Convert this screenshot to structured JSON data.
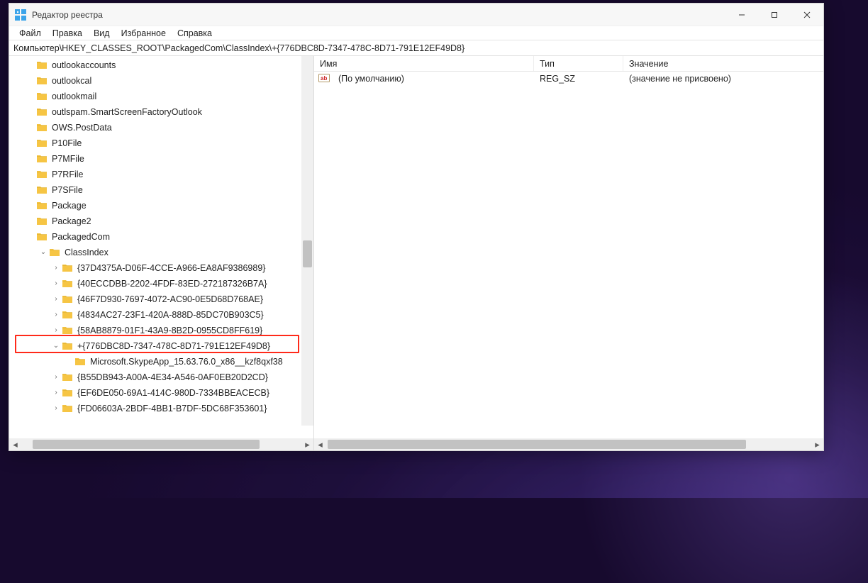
{
  "window": {
    "title": "Редактор реестра",
    "minimize": "—",
    "maximize": "▢",
    "close": "✕"
  },
  "menu": {
    "file": "Файл",
    "edit": "Правка",
    "view": "Вид",
    "favorites": "Избранное",
    "help": "Справка"
  },
  "pathbar": "Компьютер\\HKEY_CLASSES_ROOT\\PackagedCom\\ClassIndex\\+{776DBC8D-7347-478C-8D71-791E12EF49D8}",
  "tree": {
    "items": [
      {
        "indent": 1,
        "exp": "",
        "label": "outlookaccounts"
      },
      {
        "indent": 1,
        "exp": "",
        "label": "outlookcal"
      },
      {
        "indent": 1,
        "exp": "",
        "label": "outlookmail"
      },
      {
        "indent": 1,
        "exp": "",
        "label": "outlspam.SmartScreenFactoryOutlook"
      },
      {
        "indent": 1,
        "exp": "",
        "label": "OWS.PostData"
      },
      {
        "indent": 1,
        "exp": "",
        "label": "P10File"
      },
      {
        "indent": 1,
        "exp": "",
        "label": "P7MFile"
      },
      {
        "indent": 1,
        "exp": "",
        "label": "P7RFile"
      },
      {
        "indent": 1,
        "exp": "",
        "label": "P7SFile"
      },
      {
        "indent": 1,
        "exp": "",
        "label": "Package"
      },
      {
        "indent": 1,
        "exp": "",
        "label": "Package2"
      },
      {
        "indent": 1,
        "exp": "",
        "label": "PackagedCom"
      },
      {
        "indent": 2,
        "exp": "open",
        "label": "ClassIndex"
      },
      {
        "indent": 3,
        "exp": "closed",
        "label": "{37D4375A-D06F-4CCE-A966-EA8AF9386989}"
      },
      {
        "indent": 3,
        "exp": "closed",
        "label": "{40ECCDBB-2202-4FDF-83ED-272187326B7A}"
      },
      {
        "indent": 3,
        "exp": "closed",
        "label": "{46F7D930-7697-4072-AC90-0E5D68D768AE}"
      },
      {
        "indent": 3,
        "exp": "closed",
        "label": "{4834AC27-23F1-420A-888D-85DC70B903C5}"
      },
      {
        "indent": 3,
        "exp": "closed",
        "label": "{58AB8879-01F1-43A9-8B2D-0955CD8FF619}"
      },
      {
        "indent": 3,
        "exp": "open",
        "label": "+{776DBC8D-7347-478C-8D71-791E12EF49D8}",
        "highlighted": true
      },
      {
        "indent": 4,
        "exp": "",
        "label": "Microsoft.SkypeApp_15.63.76.0_x86__kzf8qxf38"
      },
      {
        "indent": 3,
        "exp": "closed",
        "label": "{B55DB943-A00A-4E34-A546-0AF0EB20D2CD}"
      },
      {
        "indent": 3,
        "exp": "closed",
        "label": "{EF6DE050-69A1-414C-980D-7334BBEACECB}"
      },
      {
        "indent": 3,
        "exp": "closed",
        "label": "{FD06603A-2BDF-4BB1-B7DF-5DC68F353601}"
      }
    ]
  },
  "list": {
    "headers": {
      "name": "Имя",
      "type": "Тип",
      "data": "Значение"
    },
    "rows": [
      {
        "name": "(По умолчанию)",
        "type": "REG_SZ",
        "data": "(значение не присвоено)"
      }
    ]
  },
  "columns": {
    "name_w": 310,
    "type_w": 126
  }
}
